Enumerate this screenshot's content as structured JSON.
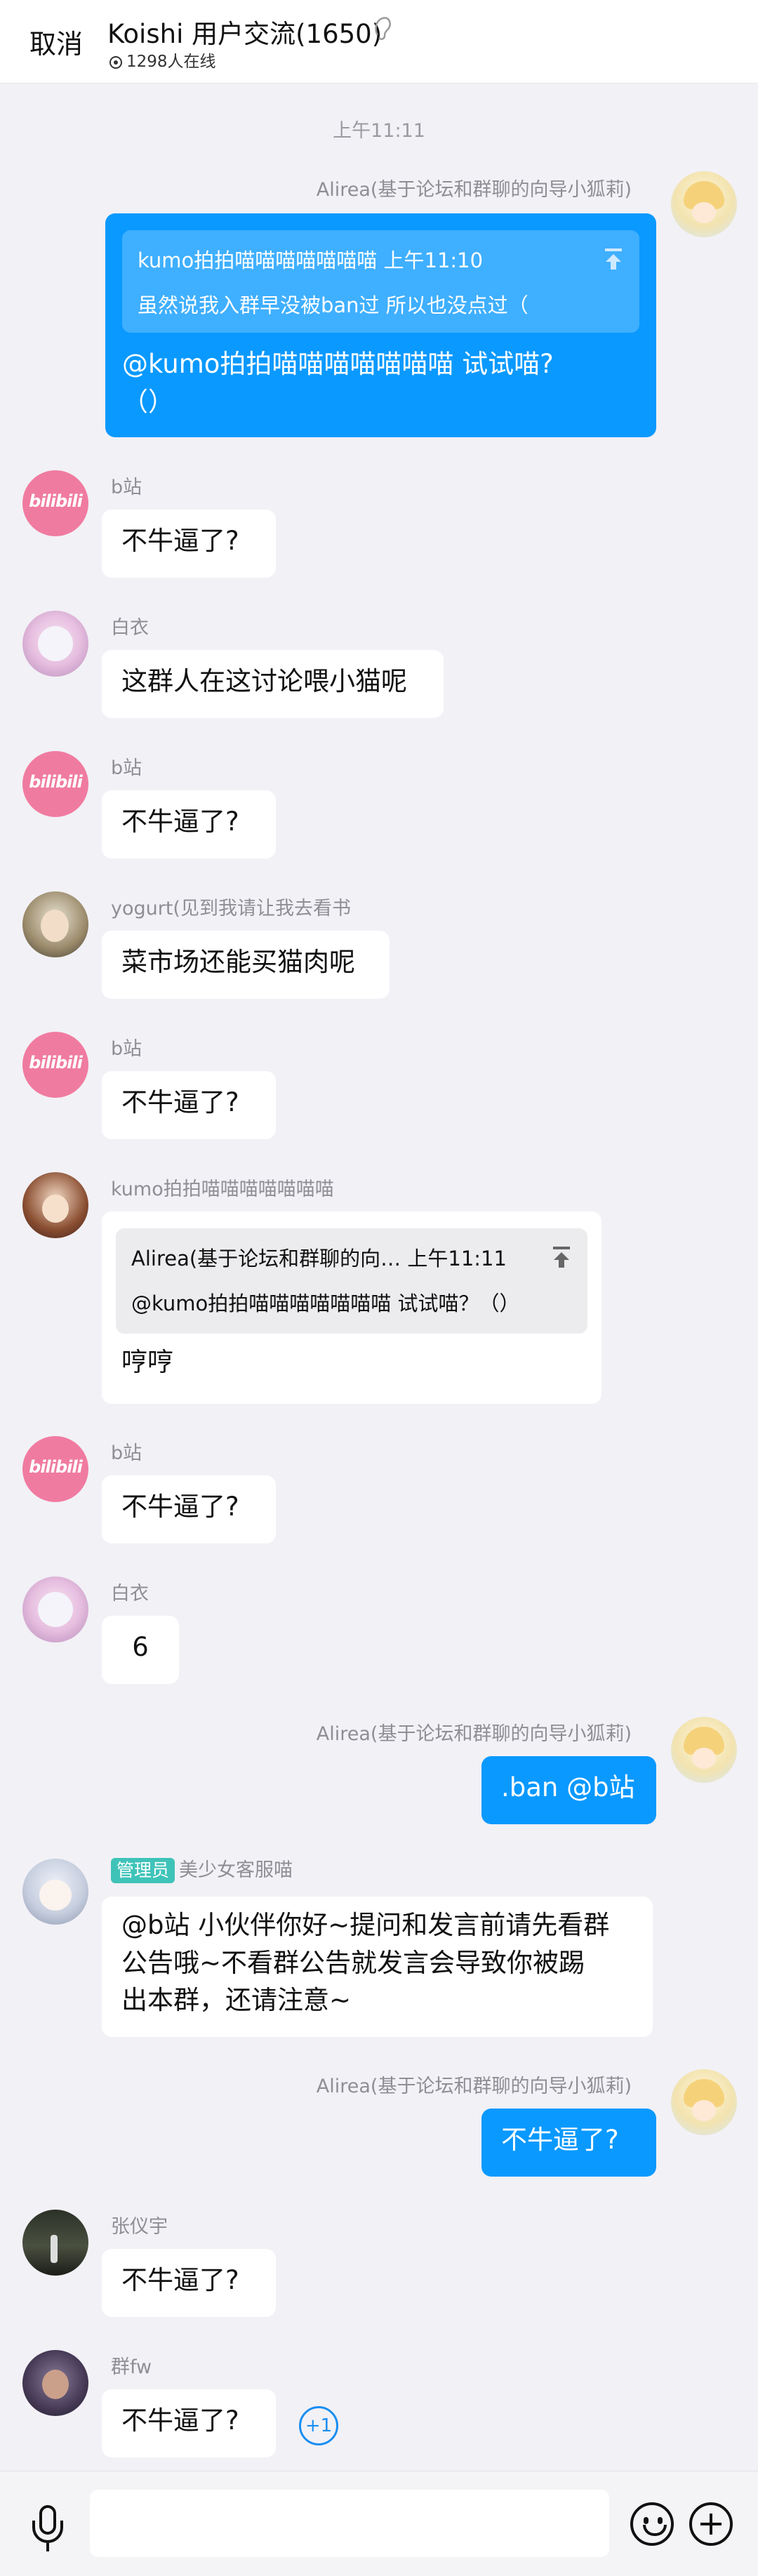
{
  "header": {
    "cancel": "取消",
    "title": "Koishi 用户交流(1650)",
    "online": "1298人在线"
  },
  "timestamp": "上午11:11",
  "names": {
    "alirea": "Alirea(基于论坛和群聊的向导小狐莉)",
    "bili": "b站",
    "baiyi": "白衣",
    "yogurt": "yogurt(见到我请让我去看书",
    "kumo": "kumo拍拍喵喵喵喵喵喵喵",
    "meng": "美少女客服喵",
    "admin_badge": "管理员",
    "zhang": "张仪宇",
    "qun": "群fw"
  },
  "messages": {
    "m1_quote_head": "kumo拍拍喵喵喵喵喵喵喵 上午11:10",
    "m1_quote_body": "虽然说我入群早没被ban过 所以也没点过（",
    "m1_text_line1": "@kumo拍拍喵喵喵喵喵喵喵 试试喵?",
    "m1_text_line2": "（）",
    "bili_text": "不牛逼了?",
    "baiyi_text": "这群人在这讨论喂小猫呢",
    "yogurt_text": "菜市场还能买猫肉呢",
    "kumo_quote_head": "Alirea(基于论坛和群聊的向…   上午11:11",
    "kumo_quote_body": "@kumo拍拍喵喵喵喵喵喵喵 试试喵？（）",
    "kumo_text": "哼哼",
    "baiyi_six": "6",
    "alirea_ban": ".ban @b站",
    "meng_line1": "@b站 小伙伴你好~提问和发言前请先看群",
    "meng_line2": "公告哦~不看群公告就发言会导致你被踢",
    "meng_line3": "出本群，还请注意~",
    "alirea_text": "不牛逼了?",
    "zhang_text": "不牛逼了?",
    "qun_text": "不牛逼了?",
    "plus_one": "+1"
  },
  "avatars": {
    "bili_logo": "bilibili"
  },
  "colors": {
    "outgoing_bubble": "#0a99ff",
    "background": "#f2f1f6",
    "admin_badge": "#3fc3b9"
  },
  "icons": [
    "ear-icon",
    "online-icon",
    "pin-top-icon",
    "mic-icon",
    "emoji-icon",
    "plus-icon"
  ]
}
